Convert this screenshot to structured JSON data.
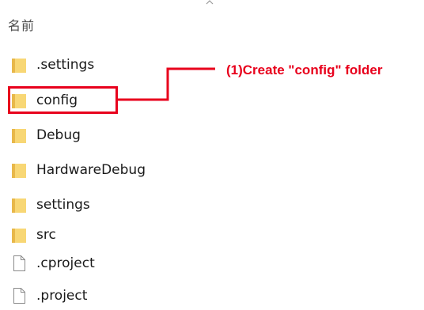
{
  "header": {
    "column_label": "名前",
    "sort_icon": "chevron-up-icon"
  },
  "files": [
    {
      "name": ".settings",
      "type": "folder",
      "icon": "folder-icon"
    },
    {
      "name": "config",
      "type": "folder",
      "icon": "folder-icon"
    },
    {
      "name": "Debug",
      "type": "folder",
      "icon": "folder-icon"
    },
    {
      "name": "HardwareDebug",
      "type": "folder",
      "icon": "folder-icon"
    },
    {
      "name": "settings",
      "type": "folder",
      "icon": "folder-icon"
    },
    {
      "name": "src",
      "type": "folder",
      "icon": "folder-icon"
    },
    {
      "name": ".cproject",
      "type": "file",
      "icon": "file-icon"
    },
    {
      "name": ".project",
      "type": "file",
      "icon": "file-icon"
    }
  ],
  "annotation": {
    "text": "(1)Create \"config\" folder",
    "color": "#e8001c",
    "highlighted_item": "config"
  },
  "colors": {
    "folder": "#f8d775",
    "folder_dark": "#e8b84a",
    "file_outline": "#8a8a8a",
    "accent_red": "#e8001c"
  }
}
